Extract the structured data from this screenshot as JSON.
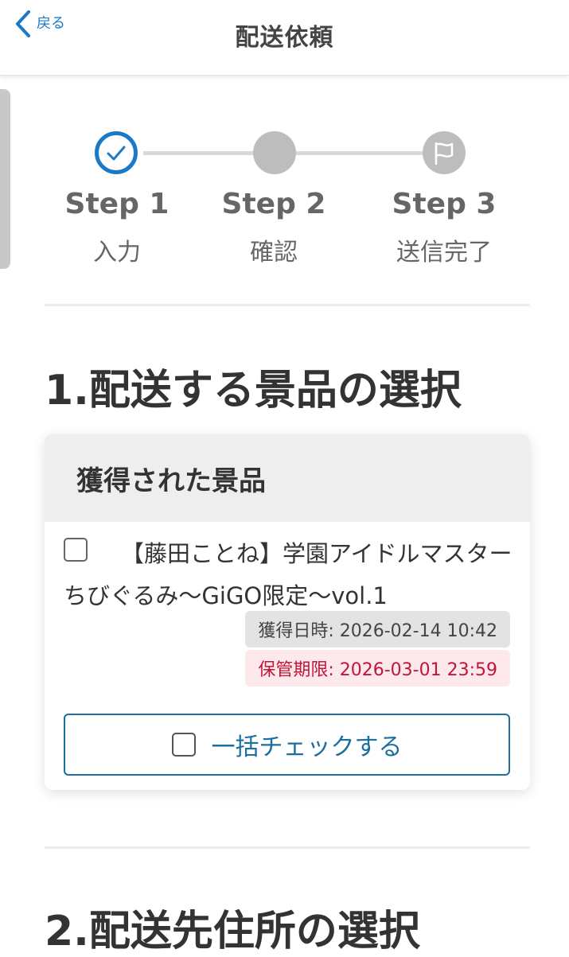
{
  "header": {
    "back_label": "戻る",
    "title": "配送依頼"
  },
  "stepper": {
    "steps": [
      {
        "title": "Step 1",
        "label": "入力",
        "state": "completed"
      },
      {
        "title": "Step 2",
        "label": "確認",
        "state": "pending"
      },
      {
        "title": "Step 3",
        "label": "送信完了",
        "state": "pending"
      }
    ]
  },
  "section1": {
    "heading": "1.配送する景品の選択",
    "card": {
      "header": "獲得された景品",
      "prizes": [
        {
          "name": "【藤田ことね】学園アイドルマスター ちびぐるみ～GiGO限定～vol.1",
          "acquired": "獲得日時: 2026-02-14 10:42",
          "expiry": "保管期限: 2026-03-01 23:59",
          "checked": false
        }
      ],
      "bulk_check_label": "一括チェックする"
    }
  },
  "section2": {
    "heading": "2.配送先住所の選択"
  },
  "colors": {
    "accent": "#1a7ac7",
    "button_border": "#1a6f9e",
    "expiry_text": "#c0163a",
    "expiry_bg": "#fde8ec",
    "step_inactive": "#bdbdbd"
  }
}
